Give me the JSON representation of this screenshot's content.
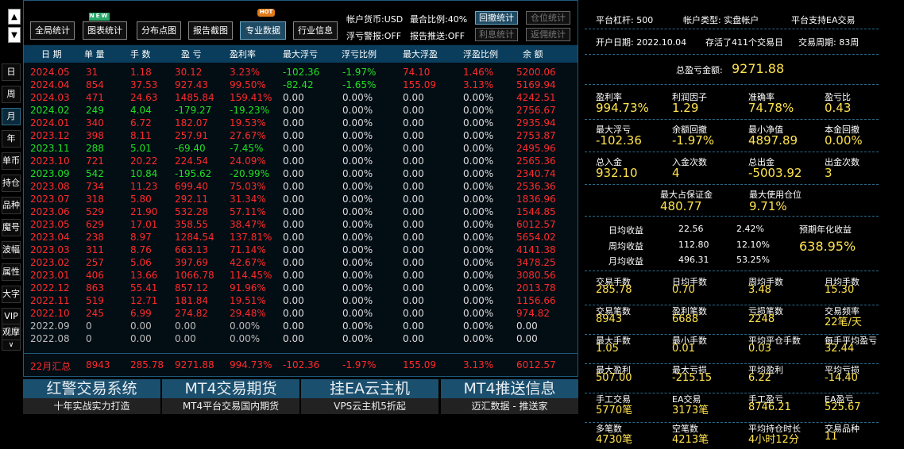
{
  "leftnav": {
    "up_arrow": "▲",
    "down_arrow": "▼",
    "items": [
      "日",
      "周",
      "月",
      "年",
      "单币",
      "持仓",
      "品种",
      "魔号",
      "波幅",
      "属性",
      "大字",
      "VIP",
      "观摩"
    ],
    "more": "∨"
  },
  "toolbar": {
    "buttons": [
      "全局统计",
      "图表统计",
      "分布点图",
      "报告截图",
      "专业数据",
      "行业信息"
    ],
    "badge_new": "NEW",
    "badge_hot": "HOT",
    "currency_label": "帐户货币:USD",
    "max_ratio_label": "最合比例:40%",
    "float_alert_label": "浮亏警报:OFF",
    "report_push_label": "报告推送:OFF",
    "stat_buttons": [
      "回撤统计",
      "仓位统计",
      "利息统计",
      "返佣统计"
    ]
  },
  "table": {
    "headers": [
      "日 期",
      "单 量",
      "手 数",
      "盈 亏",
      "盈利率",
      "最大浮亏",
      "浮亏比例",
      "最大浮盈",
      "浮盈比例",
      "余 额"
    ],
    "rows": [
      {
        "c": [
          "2024.05",
          "31",
          "1.18",
          "30.12",
          "3.23%",
          "-102.36",
          "-1.97%",
          "74.10",
          "1.46%",
          "5200.06"
        ],
        "color": "red"
      },
      {
        "c": [
          "2024.04",
          "854",
          "37.53",
          "927.43",
          "99.50%",
          "-82.42",
          "-1.65%",
          "155.09",
          "3.13%",
          "5169.94"
        ],
        "color": "red"
      },
      {
        "c": [
          "2024.03",
          "471",
          "24.63",
          "1485.84",
          "159.41%",
          "0.00",
          "0.00%",
          "0.00",
          "0.00%",
          "4242.51"
        ],
        "color": "red"
      },
      {
        "c": [
          "2024.02",
          "249",
          "4.04",
          "-179.27",
          "-19.23%",
          "0.00",
          "0.00%",
          "0.00",
          "0.00%",
          "2756.67"
        ],
        "color": "green"
      },
      {
        "c": [
          "2024.01",
          "340",
          "6.72",
          "182.07",
          "19.53%",
          "0.00",
          "0.00%",
          "0.00",
          "0.00%",
          "2935.94"
        ],
        "color": "red"
      },
      {
        "c": [
          "2023.12",
          "398",
          "8.11",
          "257.91",
          "27.67%",
          "0.00",
          "0.00%",
          "0.00",
          "0.00%",
          "2753.87"
        ],
        "color": "red"
      },
      {
        "c": [
          "2023.11",
          "288",
          "5.01",
          "-69.40",
          "-7.45%",
          "0.00",
          "0.00%",
          "0.00",
          "0.00%",
          "2495.96"
        ],
        "color": "green"
      },
      {
        "c": [
          "2023.10",
          "721",
          "20.22",
          "224.54",
          "24.09%",
          "0.00",
          "0.00%",
          "0.00",
          "0.00%",
          "2565.36"
        ],
        "color": "red"
      },
      {
        "c": [
          "2023.09",
          "542",
          "10.84",
          "-195.62",
          "-20.99%",
          "0.00",
          "0.00%",
          "0.00",
          "0.00%",
          "2340.74"
        ],
        "color": "green"
      },
      {
        "c": [
          "2023.08",
          "734",
          "11.23",
          "699.40",
          "75.03%",
          "0.00",
          "0.00%",
          "0.00",
          "0.00%",
          "2536.36"
        ],
        "color": "red"
      },
      {
        "c": [
          "2023.07",
          "318",
          "5.80",
          "292.11",
          "31.34%",
          "0.00",
          "0.00%",
          "0.00",
          "0.00%",
          "1836.96"
        ],
        "color": "red"
      },
      {
        "c": [
          "2023.06",
          "529",
          "21.90",
          "532.28",
          "57.11%",
          "0.00",
          "0.00%",
          "0.00",
          "0.00%",
          "1544.85"
        ],
        "color": "red"
      },
      {
        "c": [
          "2023.05",
          "629",
          "17.01",
          "358.55",
          "38.47%",
          "0.00",
          "0.00%",
          "0.00",
          "0.00%",
          "6012.57"
        ],
        "color": "red"
      },
      {
        "c": [
          "2023.04",
          "238",
          "8.97",
          "1284.54",
          "137.81%",
          "0.00",
          "0.00%",
          "0.00",
          "0.00%",
          "5654.02"
        ],
        "color": "red"
      },
      {
        "c": [
          "2023.03",
          "311",
          "8.76",
          "663.13",
          "71.14%",
          "0.00",
          "0.00%",
          "0.00",
          "0.00%",
          "4141.38"
        ],
        "color": "red"
      },
      {
        "c": [
          "2023.02",
          "257",
          "5.06",
          "397.69",
          "42.67%",
          "0.00",
          "0.00%",
          "0.00",
          "0.00%",
          "3478.25"
        ],
        "color": "red"
      },
      {
        "c": [
          "2023.01",
          "406",
          "13.66",
          "1066.78",
          "114.45%",
          "0.00",
          "0.00%",
          "0.00",
          "0.00%",
          "3080.56"
        ],
        "color": "red"
      },
      {
        "c": [
          "2022.12",
          "863",
          "55.41",
          "857.12",
          "91.96%",
          "0.00",
          "0.00%",
          "0.00",
          "0.00%",
          "2013.78"
        ],
        "color": "red"
      },
      {
        "c": [
          "2022.11",
          "519",
          "12.71",
          "181.84",
          "19.51%",
          "0.00",
          "0.00%",
          "0.00",
          "0.00%",
          "1156.66"
        ],
        "color": "red"
      },
      {
        "c": [
          "2022.10",
          "245",
          "6.99",
          "274.82",
          "29.48%",
          "0.00",
          "0.00%",
          "0.00",
          "0.00%",
          "974.82"
        ],
        "color": "red"
      },
      {
        "c": [
          "2022.09",
          "0",
          "0.00",
          "0.00",
          "0.00%",
          "0.00",
          "0.00%",
          "0.00",
          "0.00%",
          "0.00"
        ],
        "color": "gray"
      },
      {
        "c": [
          "2022.08",
          "0",
          "0.00",
          "0.00",
          "0.00%",
          "0.00",
          "0.00%",
          "0.00",
          "0.00%",
          "0.00"
        ],
        "color": "gray"
      }
    ],
    "summary": [
      "22月汇总",
      "8943",
      "285.78",
      "9271.88",
      "994.73%",
      "-102.36",
      "-1.97%",
      "155.09",
      "3.13%",
      "6012.57"
    ]
  },
  "banners": [
    {
      "title": "红警交易系统",
      "sub": "十年实战实力打造"
    },
    {
      "title": "MT4交易期货",
      "sub": "MT4平台交易国内期货"
    },
    {
      "title": "挂EA云主机",
      "sub": "VPS云主机5折起"
    },
    {
      "title": "MT4推送信息",
      "sub": "迈汇数据 - 推送家"
    }
  ],
  "stats": {
    "platform_leverage": "平台杠杆: 500",
    "account_type": "帐户类型: 实盘帐户",
    "ea_support": "平台支持EA交易",
    "open_date": "开户日期: 2022.10.04",
    "days_alive": "存活了411个交易日",
    "trade_cycle": "交易周期: 83周",
    "total_pnl_label": "总盈亏金额:",
    "total_pnl_value": "9271.88",
    "grid1": [
      {
        "l": "盈利率",
        "v": "994.73%"
      },
      {
        "l": "利润因子",
        "v": "1.29"
      },
      {
        "l": "准确率",
        "v": "74.78%"
      },
      {
        "l": "盈亏比",
        "v": "0.43"
      },
      {
        "l": "最大浮亏",
        "v": "-102.36"
      },
      {
        "l": "余额回撤",
        "v": "-1.97%"
      },
      {
        "l": "最小净值",
        "v": "4897.89"
      },
      {
        "l": "本金回撤",
        "v": "0.00%"
      },
      {
        "l": "总入金",
        "v": "932.10"
      },
      {
        "l": "入金次数",
        "v": "4"
      },
      {
        "l": "总出金",
        "v": "-5003.92"
      },
      {
        "l": "出金次数",
        "v": "3"
      }
    ],
    "max_margin_label": "最大占保证金",
    "max_margin_value": "480.77",
    "max_position_label": "最大使用仓位",
    "max_position_value": "9.71%",
    "daily_label": "日均收益",
    "daily_amt": "22.56",
    "daily_pct": "2.42%",
    "weekly_label": "周均收益",
    "weekly_amt": "112.80",
    "weekly_pct": "12.10%",
    "monthly_label": "月均收益",
    "monthly_amt": "496.31",
    "monthly_pct": "53.25%",
    "annual_label": "预期年化收益",
    "annual_value": "638.95%",
    "grid2": [
      {
        "l": "交易手数",
        "v": "285.78"
      },
      {
        "l": "日均手数",
        "v": "0.70"
      },
      {
        "l": "周均手数",
        "v": "3.48"
      },
      {
        "l": "月均手数",
        "v": "15.30"
      },
      {
        "l": "交易笔数",
        "v": "8943"
      },
      {
        "l": "盈利笔数",
        "v": "6688"
      },
      {
        "l": "亏损笔数",
        "v": "2248"
      },
      {
        "l": "交易频率",
        "v": "22笔/天"
      },
      {
        "l": "最大手数",
        "v": "1.05"
      },
      {
        "l": "最小手数",
        "v": "0.01"
      },
      {
        "l": "平均平仓手数",
        "v": "0.03"
      },
      {
        "l": "每手平均盈亏",
        "v": "32.44"
      },
      {
        "l": "最大盈利",
        "v": "507.00"
      },
      {
        "l": "最大亏损",
        "v": "-215.15"
      },
      {
        "l": "平均盈利",
        "v": "6.22"
      },
      {
        "l": "平均亏损",
        "v": "-14.40"
      },
      {
        "l": "手工交易",
        "v": "5770笔"
      },
      {
        "l": "EA交易",
        "v": "3173笔"
      },
      {
        "l": "手工盈亏",
        "v": "8746.21"
      },
      {
        "l": "EA盈亏",
        "v": "525.67"
      },
      {
        "l": "多笔数",
        "v": "4730笔"
      },
      {
        "l": "空笔数",
        "v": "4213笔"
      },
      {
        "l": "平均持仓时长",
        "v": "4小时12分"
      },
      {
        "l": "交易品种",
        "v": "11"
      }
    ]
  },
  "colors": {
    "red": "#ff2a2a",
    "green": "#22e022",
    "gray": "#bbbbbb",
    "accent": "#ffe34d",
    "header_bg": "#0a3d5c"
  }
}
